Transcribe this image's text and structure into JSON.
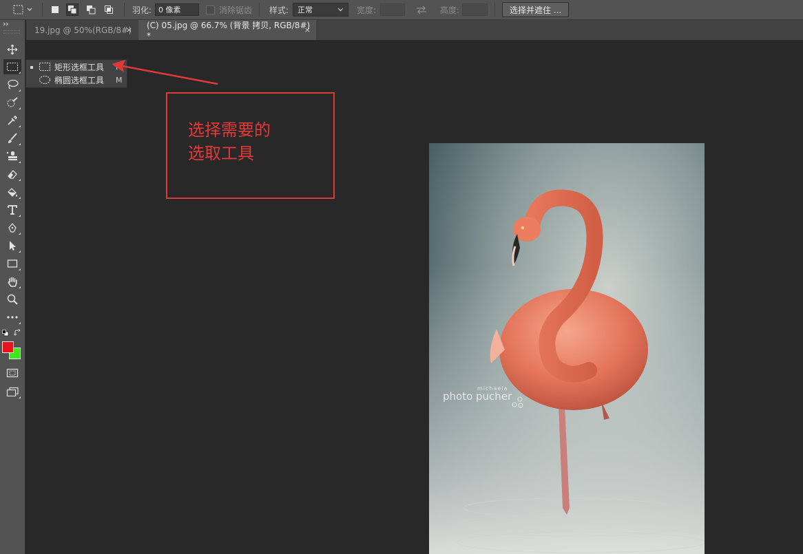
{
  "options_bar": {
    "feather_label": "羽化:",
    "feather_value": "0 像素",
    "antialias_label": "消除锯齿",
    "style_label": "样式:",
    "style_value": "正常",
    "width_label": "宽度:",
    "height_label": "高度:",
    "select_mask_button": "选择并遮住 ..."
  },
  "tabs": [
    {
      "label": "19.jpg @ 50%(RGB/8#)",
      "close": "×",
      "active": false
    },
    {
      "label": "(C) 05.jpg @ 66.7% (背景 拷贝, RGB/8#) *",
      "close": "×",
      "active": true
    }
  ],
  "flyout": {
    "items": [
      {
        "label": "矩形选框工具",
        "shortcut": "M",
        "icon": "rect-marquee-icon",
        "selected": true
      },
      {
        "label": "椭圆选框工具",
        "shortcut": "M",
        "icon": "ellipse-marquee-icon",
        "selected": false
      }
    ]
  },
  "annotation": {
    "line1": "选择需要的",
    "line2": "选取工具",
    "color": "#e0393a"
  },
  "canvas": {
    "watermark_small": "michaela",
    "watermark_big": "photo pucher"
  },
  "colors": {
    "foreground": "#e8141c",
    "background": "#3ee81e",
    "ui_panel": "#535353",
    "workspace": "#282828"
  },
  "toolbar": {
    "tools": [
      "move-icon",
      "rect-marquee-icon",
      "lasso-icon",
      "quick-select-icon",
      "eyedropper-icon",
      "brush-icon",
      "stamp-icon",
      "eraser-icon",
      "paint-bucket-icon",
      "type-icon",
      "pen-icon",
      "path-select-icon",
      "rectangle-shape-icon",
      "hand-icon",
      "zoom-icon",
      "more-icon"
    ]
  }
}
